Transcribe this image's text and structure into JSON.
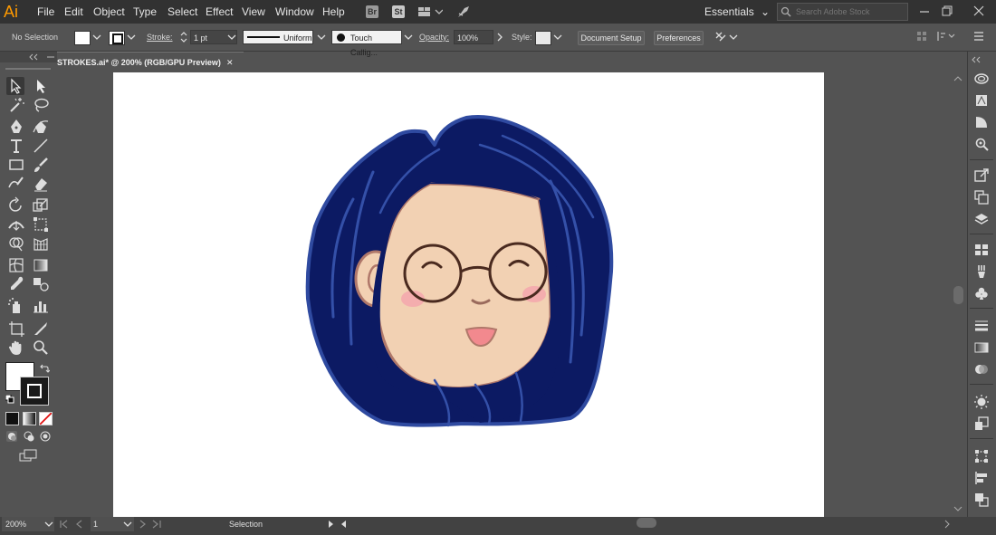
{
  "app": {
    "logo_text": "Ai"
  },
  "menu": [
    "File",
    "Edit",
    "Object",
    "Type",
    "Select",
    "Effect",
    "View",
    "Window",
    "Help"
  ],
  "menubar_icons": {
    "bridge": "Br",
    "stock": "St"
  },
  "workspace": "Essentials",
  "search": {
    "placeholder": "Search Adobe Stock"
  },
  "control": {
    "selection_label": "No Selection",
    "stroke_label": "Stroke:",
    "stroke_weight": "1 pt",
    "profile_label": "Uniform",
    "brush_label": "Touch Callig...",
    "opacity_label": "Opacity:",
    "opacity_value": "100%",
    "style_label": "Style:",
    "document_setup": "Document Setup",
    "preferences": "Preferences"
  },
  "document": {
    "tab_title": "STROKES.ai* @ 200% (RGB/GPU Preview)",
    "close": "✕"
  },
  "status": {
    "zoom": "200%",
    "artboard_number": "1",
    "current_tool": "Selection"
  },
  "colors": {
    "hair": "#0c1a63",
    "hair_outline": "#2f4aa0",
    "skin": "#f2d1b3",
    "cheek": "#f4a8ad",
    "glasses": "#4a2a1f",
    "tongue": "#f2898e",
    "accent_logo": "#ff9a00"
  }
}
